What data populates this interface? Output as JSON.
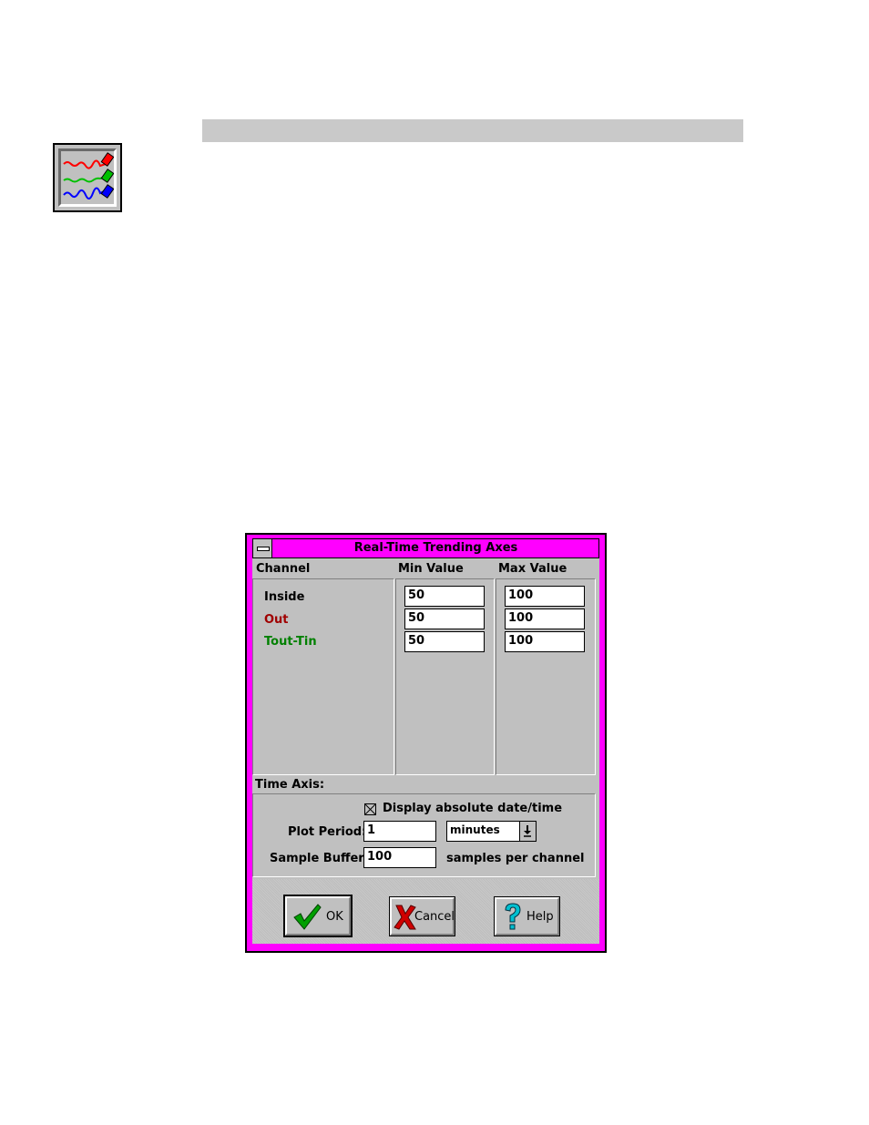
{
  "icon": {
    "name": "realtime-trend-icon",
    "colors": [
      "#ff0000",
      "#00c000",
      "#0000ff"
    ]
  },
  "dialog": {
    "title": "Real-Time Trending Axes",
    "accent": "#ff00ff",
    "columns": {
      "channel": "Channel",
      "min": "Min Value",
      "max": "Max Value"
    },
    "channels": [
      {
        "name": "Inside",
        "color": "#000000",
        "min": "50",
        "max": "100"
      },
      {
        "name": "Out",
        "color": "#a00000",
        "min": "50",
        "max": "100"
      },
      {
        "name": "Tout-Tin",
        "color": "#008000",
        "min": "50",
        "max": "100"
      }
    ],
    "time_axis": {
      "section_label": "Time Axis:",
      "display_absolute_label": "Display absolute date/time",
      "display_absolute_checked": true,
      "plot_period_label": "Plot Period:",
      "plot_period_value": "1",
      "plot_period_unit": "minutes",
      "sample_buffer_label": "Sample Buffer:",
      "sample_buffer_value": "100",
      "sample_buffer_suffix": "samples per channel"
    },
    "buttons": {
      "ok": "OK",
      "cancel": "Cancel",
      "help": "Help"
    }
  }
}
